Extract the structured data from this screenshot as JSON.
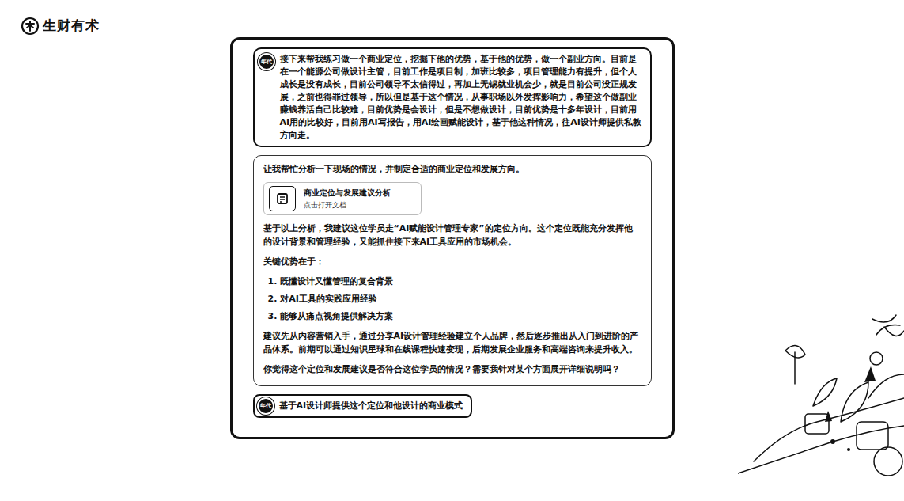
{
  "logo": {
    "text": "生财有术"
  },
  "user_prompt": {
    "avatar": "年代",
    "text": "接下来帮我练习做一个商业定位，挖掘下他的优势，基于他的优势，做一个副业方向。目前是在一个能源公司做设计主管，目前工作是项目制，加班比较多，项目管理能力有提升，但个人成长是没有成长，目前公司领导不太信得过，再加上无锡就业机会少，就是目前公司没正规发展，之前也得罪过领导，所以但是基于这个情况，从事职场以外发挥影响力，希望这个做副业赚钱养活自己比较难，目前优势是会设计，但是不想做设计，目前优势是十多年设计，目前用AI用的比较好，目前用AI写报告，用AI绘画赋能设计，基于他这种情况，往AI设计师提供私教方向走。"
  },
  "assistant_reply": {
    "blocks": [
      {
        "kind": "paragraph",
        "text": "让我帮忙分析一下现场的情况，并制定合适的商业定位和发展方向。"
      },
      {
        "kind": "document",
        "title": "商业定位与发展建议分析",
        "action": "点击打开文档"
      },
      {
        "kind": "paragraph",
        "text": "基于以上分析，我建议这位学员走“AI赋能设计管理专家”的定位方向。这个定位既能充分发挥他的设计背景和管理经验，又能抓住接下来AI工具应用的市场机会。"
      },
      {
        "kind": "paragraph",
        "text": "关键优势在于："
      },
      {
        "kind": "list",
        "items": [
          "1. 既懂设计又懂管理的复合背景",
          "2. 对AI工具的实践应用经验",
          "3. 能够从痛点视角提供解决方案"
        ]
      },
      {
        "kind": "paragraph",
        "text": "建议先从内容营销入手，通过分享AI设计管理经验建立个人品牌，然后逐步推出从入门到进阶的产品体系。前期可以通过知识星球和在线课程快速变现，后期发展企业服务和高端咨询来提升收入。"
      },
      {
        "kind": "paragraph",
        "text": "你觉得这个定位和发展建议是否符合这位学员的情况？需要我针对某个方面展开详细说明吗？"
      }
    ]
  },
  "follow_up": {
    "avatar": "年代",
    "text": "基于AI设计师提供这个定位和他设计的商业模式"
  }
}
